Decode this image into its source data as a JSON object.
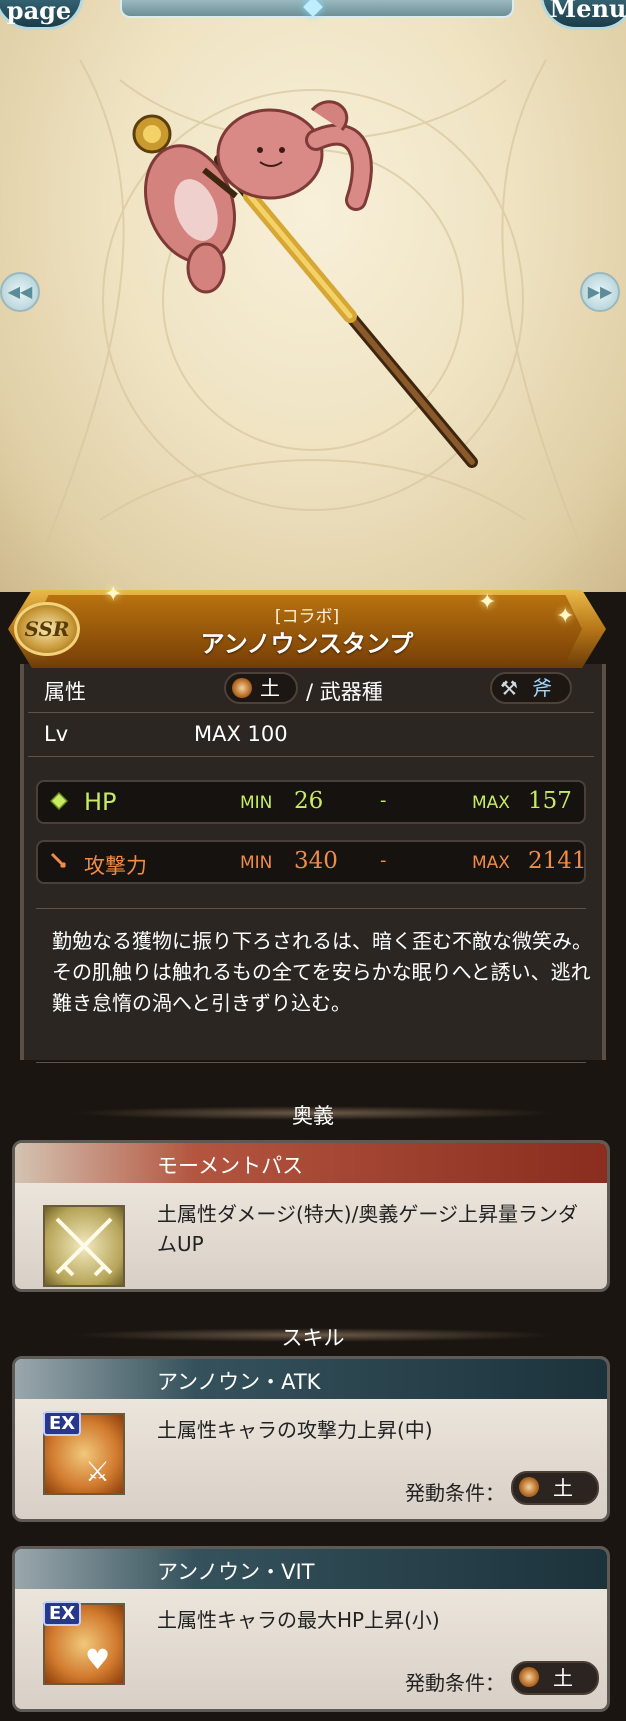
{
  "topbar": {
    "page_label": "page",
    "menu_label": "Menu"
  },
  "weapon": {
    "rarity": "SSR",
    "collab_tag": "[コラボ]",
    "name": "アンノウンスタンプ"
  },
  "stats": {
    "attribute_label": "属性",
    "attribute_value": "土",
    "weapon_type_label": "/ 武器種",
    "weapon_type_value": "斧",
    "lv_label": "Lv",
    "lv_value": "MAX 100"
  },
  "hp": {
    "label": "HP",
    "min_label": "MIN",
    "min": "26",
    "dash": "-",
    "max_label": "MAX",
    "max": "157"
  },
  "atk": {
    "label": "攻撃力",
    "min_label": "MIN",
    "min": "340",
    "dash": "-",
    "max_label": "MAX",
    "max": "2141"
  },
  "description": "勤勉なる獲物に振り下ろされるは、暗く歪む不敵な微笑み。その肌触りは触れるもの全てを安らかな眠りへと誘い、逃れ難き怠惰の渦へと引きずり込む。",
  "ougi": {
    "section_title": "奥義",
    "name": "モーメントパス",
    "text": "土属性ダメージ(特大)/奥義ゲージ上昇量ランダムUP"
  },
  "skills": {
    "section_title": "スキル",
    "items": [
      {
        "tag": "EX",
        "name": "アンノウン・ATK",
        "text": "土属性キャラの攻撃力上昇(中)",
        "cond_label": "発動条件：",
        "cond_value": "土"
      },
      {
        "tag": "EX",
        "name": "アンノウン・VIT",
        "text": "土属性キャラの最大HP上昇(小)",
        "cond_label": "発動条件：",
        "cond_value": "土"
      }
    ]
  },
  "colors": {
    "hp": "#c7ec62",
    "atk": "#f08b49",
    "banner_gold": "#b77618",
    "skill_head": "#1c323b",
    "ougi_head": "#8a2c1e"
  }
}
